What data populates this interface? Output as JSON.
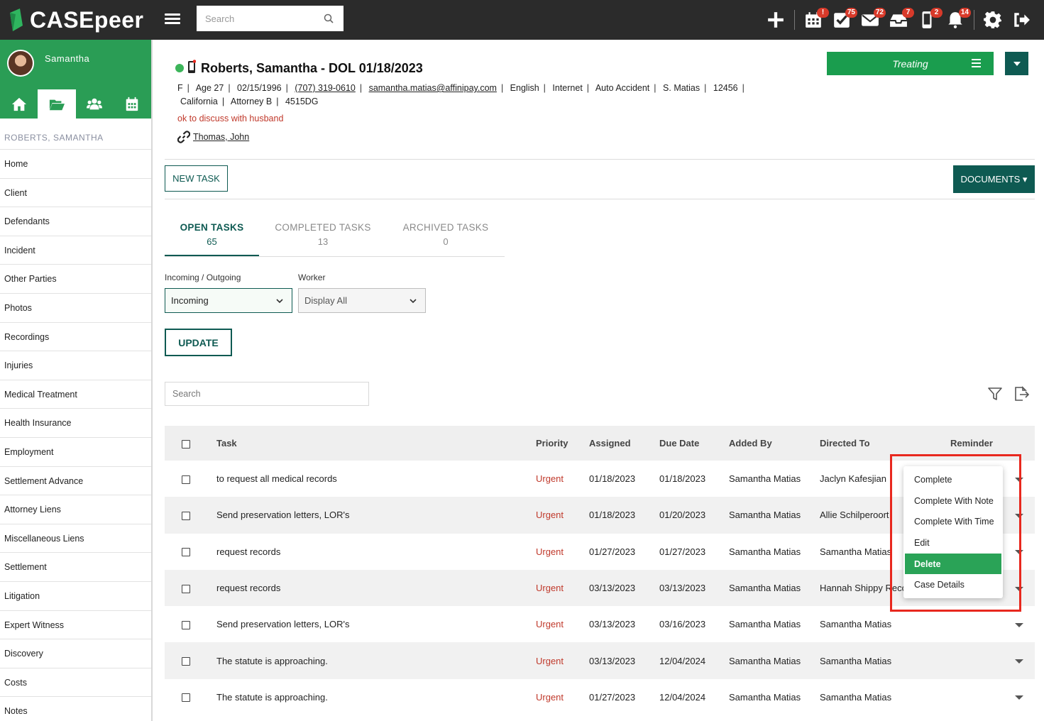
{
  "app": {
    "brand": "CASEpeer",
    "search_placeholder": "Search"
  },
  "topbar": {
    "badges": {
      "calendar": "!",
      "tasks": "75",
      "mail": "72",
      "inbox": "7",
      "phone": "2",
      "bell": "14"
    }
  },
  "sidebar": {
    "user_name": "Samantha",
    "case_name": "ROBERTS, SAMANTHA",
    "items": [
      "Home",
      "Client",
      "Defendants",
      "Incident",
      "Other Parties",
      "Photos",
      "Recordings",
      "Injuries",
      "Medical Treatment",
      "Health Insurance",
      "Employment",
      "Settlement Advance",
      "Attorney Liens",
      "Miscellaneous Liens",
      "Settlement",
      "Litigation",
      "Expert Witness",
      "Discovery",
      "Costs",
      "Notes"
    ]
  },
  "case": {
    "title": "Roberts, Samantha - DOL 01/18/2023",
    "gender": "F",
    "age": "Age 27",
    "dob": "02/15/1996",
    "phone": "(707) 319-0610",
    "email": "samantha.matias@affinipay.com",
    "language": "English",
    "source": "Internet",
    "case_type": "Auto Accident",
    "staff": "S. Matias",
    "case_number": "12456",
    "state": "California",
    "attorney": "Attorney B",
    "code": "4515DG",
    "note": "ok to discuss with husband",
    "linked_contact": "Thomas, John",
    "status": "Treating"
  },
  "actions": {
    "new_task": "NEW TASK",
    "documents": "DOCUMENTS ▾",
    "update": "UPDATE"
  },
  "tabs": [
    {
      "label": "OPEN TASKS",
      "count": "65"
    },
    {
      "label": "COMPLETED TASKS",
      "count": "13"
    },
    {
      "label": "ARCHIVED TASKS",
      "count": "0"
    }
  ],
  "filters": {
    "direction_label": "Incoming / Outgoing",
    "direction_value": "Incoming",
    "worker_label": "Worker",
    "worker_value": "Display All"
  },
  "list_search_placeholder": "Search",
  "table": {
    "headers": [
      "Task",
      "Priority",
      "Assigned",
      "Due Date",
      "Added By",
      "Directed To",
      "Reminder"
    ],
    "rows": [
      [
        "to request all medical records",
        "Urgent",
        "01/18/2023",
        "01/18/2023",
        "Samantha Matias",
        "Jaclyn Kafesjian"
      ],
      [
        "Send preservation letters, LOR's",
        "Urgent",
        "01/18/2023",
        "01/20/2023",
        "Samantha Matias",
        "Allie Schilperoort"
      ],
      [
        "request records",
        "Urgent",
        "01/27/2023",
        "01/27/2023",
        "Samantha Matias",
        "Samantha Matias"
      ],
      [
        "request records",
        "Urgent",
        "03/13/2023",
        "03/13/2023",
        "Samantha Matias",
        "Hannah Shippy Recco"
      ],
      [
        "Send preservation letters, LOR's",
        "Urgent",
        "03/13/2023",
        "03/16/2023",
        "Samantha Matias",
        "Samantha Matias"
      ],
      [
        "The statute is approaching.",
        "Urgent",
        "03/13/2023",
        "12/04/2024",
        "Samantha Matias",
        "Samantha Matias"
      ],
      [
        "The statute is approaching.",
        "Urgent",
        "01/27/2023",
        "12/04/2024",
        "Samantha Matias",
        "Samantha Matias"
      ]
    ]
  },
  "context_menu": {
    "items": [
      "Complete",
      "Complete With Note",
      "Complete With Time",
      "Edit",
      "Delete",
      "Case Details"
    ],
    "highlighted": "Delete"
  },
  "colors": {
    "brand_green": "#2a9d55",
    "dark_teal": "#0e5a52",
    "urgent_red": "#c0392b",
    "highlight_box": "#e8281e"
  }
}
